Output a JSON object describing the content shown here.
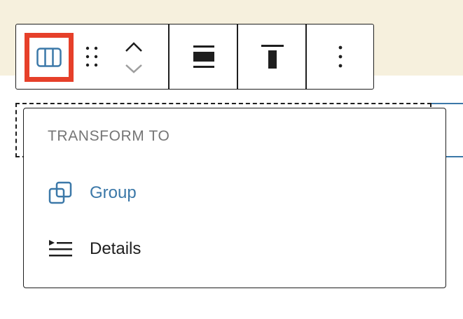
{
  "colors": {
    "top_band": "#f6f0dd",
    "highlight": "#e6402a",
    "accent": "#3b78a8",
    "text": "#1e1e1e",
    "muted": "#757575"
  },
  "toolbar": {
    "block_type_icon": "columns-icon",
    "drag_icon": "drag-handle-icon",
    "move_up_icon": "chevron-up-icon",
    "move_down_icon": "chevron-down-icon",
    "align_icon": "align-wide-icon",
    "vertical_align_icon": "align-top-icon",
    "more_icon": "more-vertical-icon"
  },
  "transform_menu": {
    "heading": "TRANSFORM TO",
    "items": [
      {
        "label": "Group",
        "icon": "group-icon"
      },
      {
        "label": "Details",
        "icon": "details-icon"
      }
    ]
  }
}
